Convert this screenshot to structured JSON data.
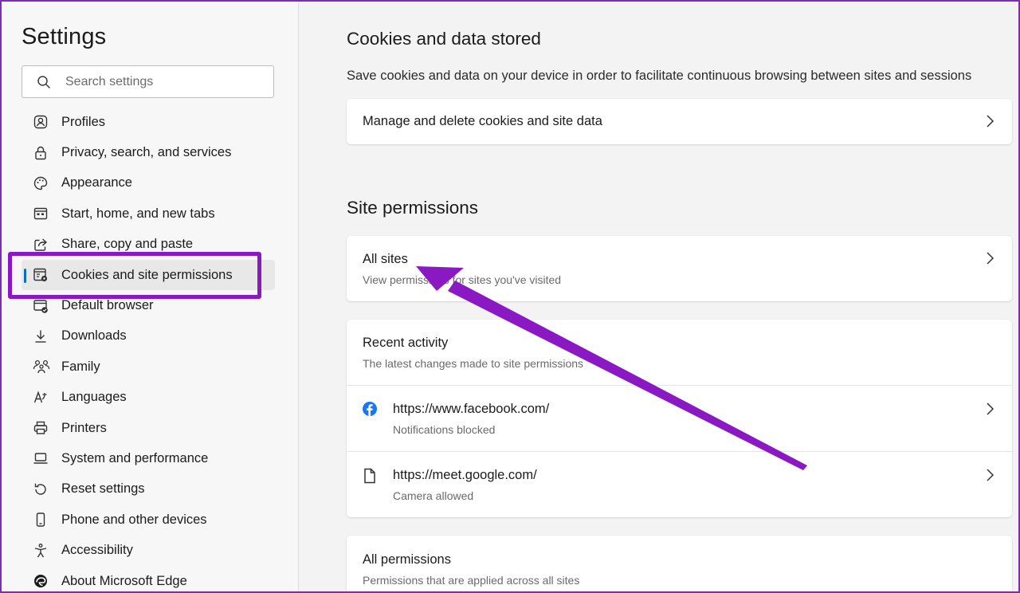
{
  "sidebar": {
    "title": "Settings",
    "search_placeholder": "Search settings",
    "items": [
      {
        "label": "Profiles",
        "icon": "profile-icon"
      },
      {
        "label": "Privacy, search, and services",
        "icon": "lock-icon"
      },
      {
        "label": "Appearance",
        "icon": "palette-icon"
      },
      {
        "label": "Start, home, and new tabs",
        "icon": "start-tabs-icon"
      },
      {
        "label": "Share, copy and paste",
        "icon": "share-icon"
      },
      {
        "label": "Cookies and site permissions",
        "icon": "cookies-icon",
        "active": true
      },
      {
        "label": "Default browser",
        "icon": "default-browser-icon"
      },
      {
        "label": "Downloads",
        "icon": "download-icon"
      },
      {
        "label": "Family",
        "icon": "family-icon"
      },
      {
        "label": "Languages",
        "icon": "languages-icon"
      },
      {
        "label": "Printers",
        "icon": "printer-icon"
      },
      {
        "label": "System and performance",
        "icon": "laptop-icon"
      },
      {
        "label": "Reset settings",
        "icon": "reset-icon"
      },
      {
        "label": "Phone and other devices",
        "icon": "phone-icon"
      },
      {
        "label": "Accessibility",
        "icon": "accessibility-icon"
      },
      {
        "label": "About Microsoft Edge",
        "icon": "edge-icon"
      }
    ]
  },
  "main": {
    "cookies_heading": "Cookies and data stored",
    "cookies_description": "Save cookies and data on your device in order to facilitate continuous browsing between sites and sessions",
    "manage_cookies_label": "Manage and delete cookies and site data",
    "site_permissions_heading": "Site permissions",
    "all_sites": {
      "title": "All sites",
      "subtitle": "View permissions for sites you've visited"
    },
    "recent_activity": {
      "title": "Recent activity",
      "subtitle": "The latest changes made to site permissions",
      "sites": [
        {
          "url": "https://www.facebook.com/",
          "status": "Notifications blocked",
          "icon": "facebook-icon"
        },
        {
          "url": "https://meet.google.com/",
          "status": "Camera allowed",
          "icon": "page-icon"
        }
      ]
    },
    "all_permissions": {
      "title": "All permissions",
      "subtitle": "Permissions that are applied across all sites"
    }
  },
  "colors": {
    "annotation_purple": "#8a19c4",
    "accent_blue": "#0f6cbd",
    "facebook_blue": "#1877f2"
  }
}
